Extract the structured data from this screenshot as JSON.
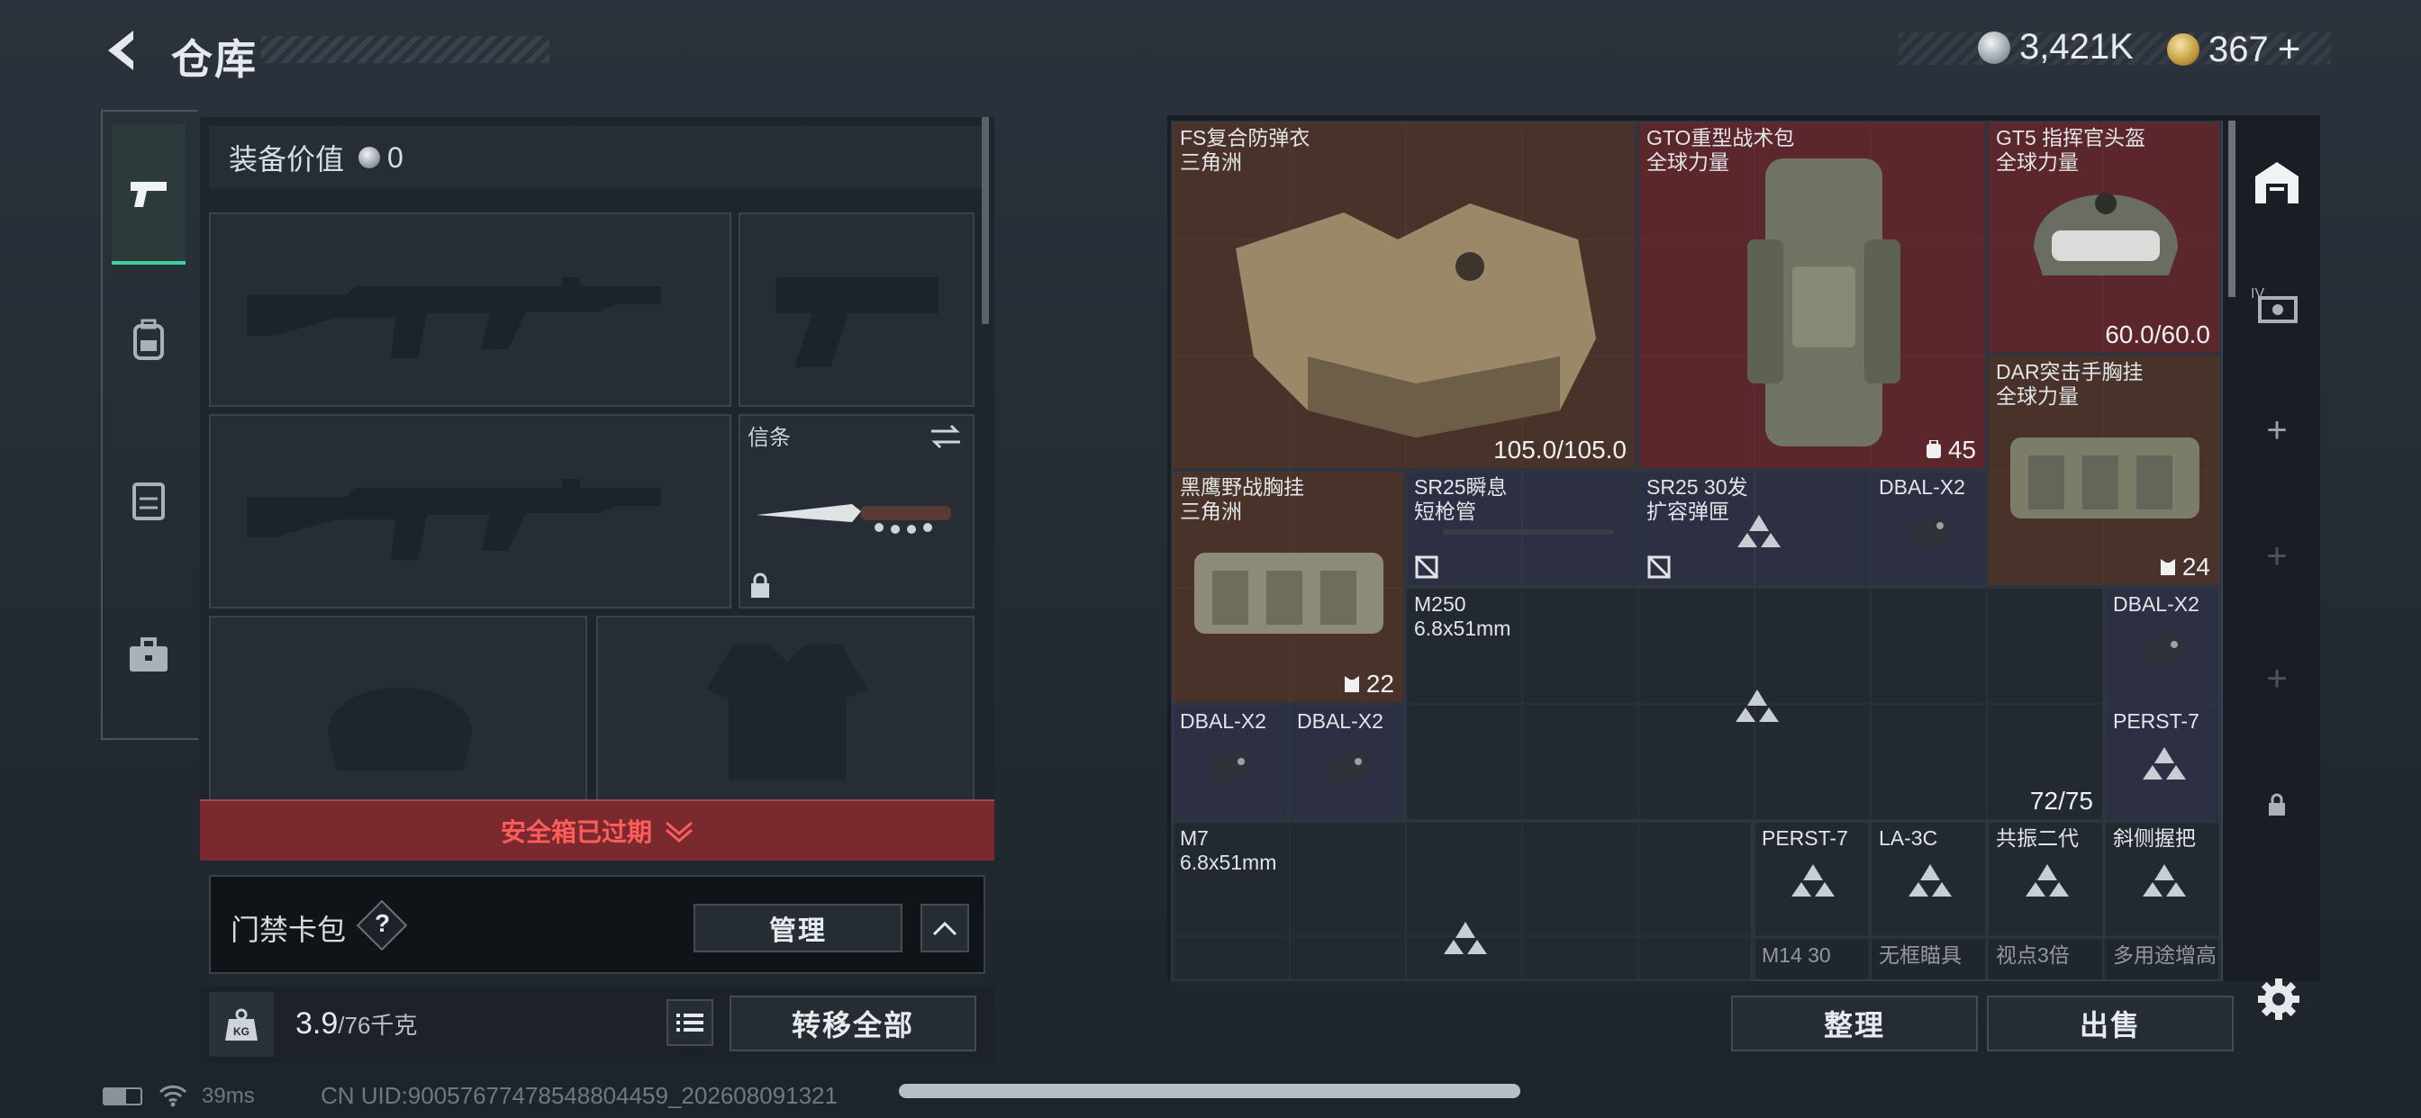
{
  "header": {
    "title": "仓库",
    "currency_silver": "3,421K",
    "currency_gold": "367",
    "gold_plus": "+"
  },
  "equipment": {
    "value_label": "装备价值",
    "value": "0",
    "melee_label": "信条"
  },
  "safe_box": {
    "expired_label": "安全箱已过期"
  },
  "card_pack": {
    "label": "门禁卡包",
    "help": "?",
    "manage_label": "管理"
  },
  "footer_left": {
    "weight": "3.9",
    "weight_max": "/76千克",
    "weight_icon": "KG",
    "transfer_all_label": "转移全部"
  },
  "status": {
    "ping": "39ms",
    "uid": "CN UID:900576774785488044​59_202608091321"
  },
  "stash": {
    "items": [
      {
        "id": "fs-armor",
        "name": "FS复合防弹衣\n三角洲",
        "value": "105.0/105.0"
      },
      {
        "id": "gto-backpack",
        "name": "GTO重型战术包\n全球力量",
        "value": "45"
      },
      {
        "id": "gt5-helmet",
        "name": "GT5 指挥官头盔\n全球力量",
        "value": "60.0/60.0"
      },
      {
        "id": "dar-rig",
        "name": "DAR突击手胸挂\n全球力量",
        "value": "24"
      },
      {
        "id": "blackhawk-rig",
        "name": "黑鹰野战胸挂\n三角洲",
        "value": "22"
      },
      {
        "id": "sr25-barrel",
        "name": "SR25瞬息\n短枪管",
        "value": ""
      },
      {
        "id": "sr25-mag",
        "name": "SR25 30发\n扩容弹匣",
        "value": ""
      },
      {
        "id": "dbal-1",
        "name": "DBAL-X2",
        "value": ""
      },
      {
        "id": "m250",
        "name": "M250\n6.8x51mm",
        "value": "72/75"
      },
      {
        "id": "dbal-2",
        "name": "DBAL-X2",
        "value": ""
      },
      {
        "id": "dbal-3",
        "name": "DBAL-X2",
        "value": ""
      },
      {
        "id": "dbal-4",
        "name": "DBAL-X2",
        "value": ""
      },
      {
        "id": "perst-1",
        "name": "PERST-7",
        "value": ""
      },
      {
        "id": "m7",
        "name": "M7\n6.8x51mm",
        "value": ""
      },
      {
        "id": "perst-2",
        "name": "PERST-7",
        "value": ""
      },
      {
        "id": "la3c",
        "name": "LA-3C",
        "value": ""
      },
      {
        "id": "gongzhen",
        "name": "共振二代",
        "value": ""
      },
      {
        "id": "xiece",
        "name": "斜侧握把",
        "value": ""
      },
      {
        "id": "m14",
        "name": "M14 30",
        "value": ""
      },
      {
        "id": "wukuang",
        "name": "无框瞄具",
        "value": ""
      },
      {
        "id": "shidian",
        "name": "视点3倍",
        "value": ""
      },
      {
        "id": "duoyong",
        "name": "多用途增高",
        "value": ""
      }
    ]
  },
  "actions": {
    "sort_label": "整理",
    "sell_label": "出售"
  },
  "colors": {
    "bg": "#262c34",
    "brown_item": "#58382a",
    "red_item": "#6e282e",
    "purple_item": "#3c3a5a",
    "alert_red": "#7a2a2e",
    "accent_green": "#3fd0a0"
  }
}
